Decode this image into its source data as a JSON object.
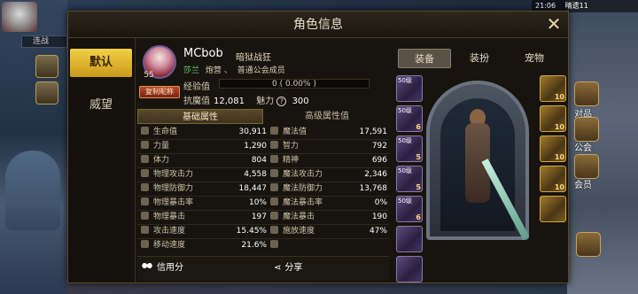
{
  "status_bar": {
    "time": "21:06",
    "carrier": "晴遗11"
  },
  "background": {
    "left_tag": "连战",
    "right_labels": [
      "对品",
      "公会",
      "会员"
    ]
  },
  "panel": {
    "title": "角色信息",
    "side_tabs": [
      {
        "label": "默认",
        "active": true
      },
      {
        "label": "威望",
        "active": false
      }
    ]
  },
  "character": {
    "name": "MCbob",
    "class": "暗狱战狂",
    "level": "55",
    "title_badge": "复制昵称",
    "server": "莎兰",
    "faction": "炮营",
    "guild_role": "普通公会成员",
    "exp_label": "经验值",
    "exp_value": "0 ( 0.00% )",
    "anti_magic_label": "抗魔值",
    "anti_magic_value": "12,081",
    "charm_label": "魅力",
    "charm_value": "300"
  },
  "attr_tabs": {
    "basic": "基础属性",
    "advanced": "高级属性值"
  },
  "attributes": [
    {
      "l_name": "生命值",
      "l_val": "30,911",
      "r_name": "魔法值",
      "r_val": "17,591"
    },
    {
      "l_name": "力量",
      "l_val": "1,290",
      "r_name": "智力",
      "r_val": "792"
    },
    {
      "l_name": "体力",
      "l_val": "804",
      "r_name": "精神",
      "r_val": "696"
    },
    {
      "l_name": "物理攻击力",
      "l_val": "4,558",
      "r_name": "魔法攻击力",
      "r_val": "2,346"
    },
    {
      "l_name": "物理防御力",
      "l_val": "18,447",
      "r_name": "魔法防御力",
      "r_val": "13,768"
    },
    {
      "l_name": "物理暴击率",
      "l_val": "10%",
      "r_name": "魔法暴击率",
      "r_val": "0%"
    },
    {
      "l_name": "物理暴击",
      "l_val": "197",
      "r_name": "魔法暴击",
      "r_val": "190"
    },
    {
      "l_name": "攻击速度",
      "l_val": "15.45%",
      "r_name": "施放速度",
      "r_val": "47%"
    },
    {
      "l_name": "移动速度",
      "l_val": "21.6%",
      "r_name": "",
      "r_val": ""
    }
  ],
  "bottom": {
    "credit": "信用分",
    "share": "分享"
  },
  "equip_tabs": [
    {
      "label": "装备",
      "active": true
    },
    {
      "label": "装扮",
      "active": false
    },
    {
      "label": "宠物",
      "active": false
    }
  ],
  "left_slots": [
    {
      "lv": "50级",
      "num": ""
    },
    {
      "lv": "50级",
      "num": "6"
    },
    {
      "lv": "50级",
      "num": "5"
    },
    {
      "lv": "50级",
      "num": "5"
    },
    {
      "lv": "50级",
      "num": "6"
    },
    {
      "lv": "",
      "num": ""
    },
    {
      "lv": "",
      "num": ""
    }
  ],
  "right_slots": [
    {
      "lv": "",
      "num": "10"
    },
    {
      "lv": "",
      "num": "10"
    },
    {
      "lv": "",
      "num": "10"
    },
    {
      "lv": "",
      "num": "10"
    },
    {
      "lv": "",
      "num": ""
    }
  ]
}
